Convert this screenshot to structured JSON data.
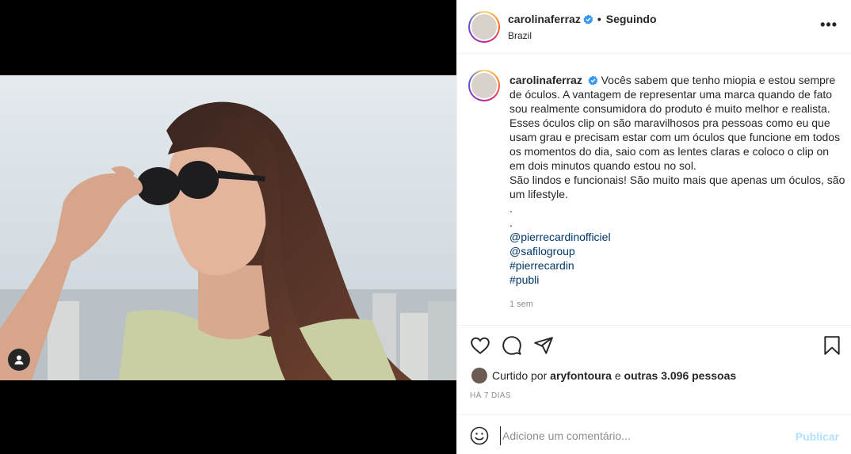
{
  "post": {
    "username": "carolinaferraz",
    "separator": "•",
    "follow_status": "Seguindo",
    "location": "Brazil",
    "more_label": "•••"
  },
  "caption": {
    "username": "carolinaferraz",
    "text_lines": [
      "Vocês sabem que tenho miopia e estou sempre de óculos. A vantagem de representar uma marca quando de fato sou realmente consumidora do produto é muito melhor e realista. Esses óculos clip on são maravilhosos pra pessoas como eu que usam grau e precisam estar com um óculos que funcione em todos os momentos do dia, saio com as lentes claras e coloco o clip on em dois minutos quando estou no sol.",
      "São lindos e funcionais! São muito mais que apenas um óculos, são um lifestyle.",
      ".",
      "."
    ],
    "mentions": [
      "@pierrecardinofficiel",
      "@safilogroup"
    ],
    "hashtags": [
      "#pierrecardin",
      "#publi"
    ],
    "time_ago": "1 sem"
  },
  "engagement": {
    "liked_prefix": "Curtido por",
    "liked_user": "aryfontoura",
    "liked_mid": "e",
    "liked_others": "outras 3.096 pessoas",
    "date": "HÁ 7 DIAS"
  },
  "comment": {
    "placeholder": "Adicione um comentário...",
    "publish_label": "Publicar"
  },
  "colors": {
    "link": "#00376b",
    "verified": "#3897f0",
    "publish_disabled": "#b2dffc",
    "muted": "#8e8e8e"
  }
}
